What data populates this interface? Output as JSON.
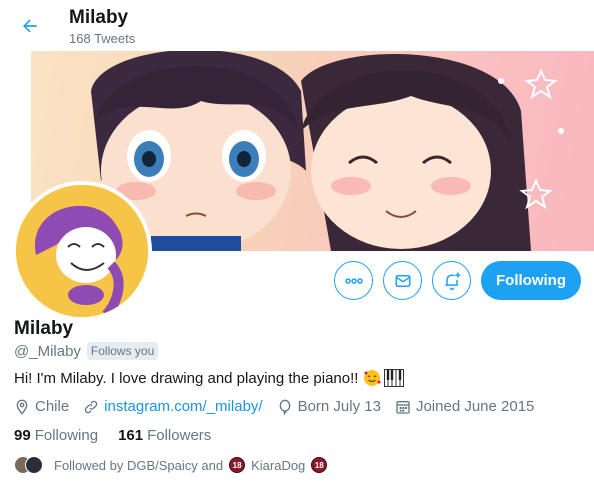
{
  "header": {
    "name": "Milaby",
    "tweet_count": "168 Tweets"
  },
  "profile": {
    "name": "Milaby",
    "handle": "@_Milaby",
    "follows_you": "Follows you",
    "bio": "Hi! I'm Milaby. I love drawing and playing the piano!!",
    "location": "Chile",
    "website": "instagram.com/_milaby/",
    "birthday": "Born July 13",
    "joined": "Joined June 2015"
  },
  "stats": {
    "following_count": "99",
    "following_label": "Following",
    "followers_count": "161",
    "followers_label": "Followers"
  },
  "followed_by": {
    "prefix": "Followed by DGB/Spaicy and",
    "second": "KiaraDog",
    "badge": "18"
  },
  "actions": {
    "more": "more-icon",
    "message": "envelope-icon",
    "notify": "bell-plus-icon",
    "following_label": "Following"
  },
  "colors": {
    "accent": "#1da1f2",
    "link": "#1b95e0",
    "muted": "#657786"
  }
}
